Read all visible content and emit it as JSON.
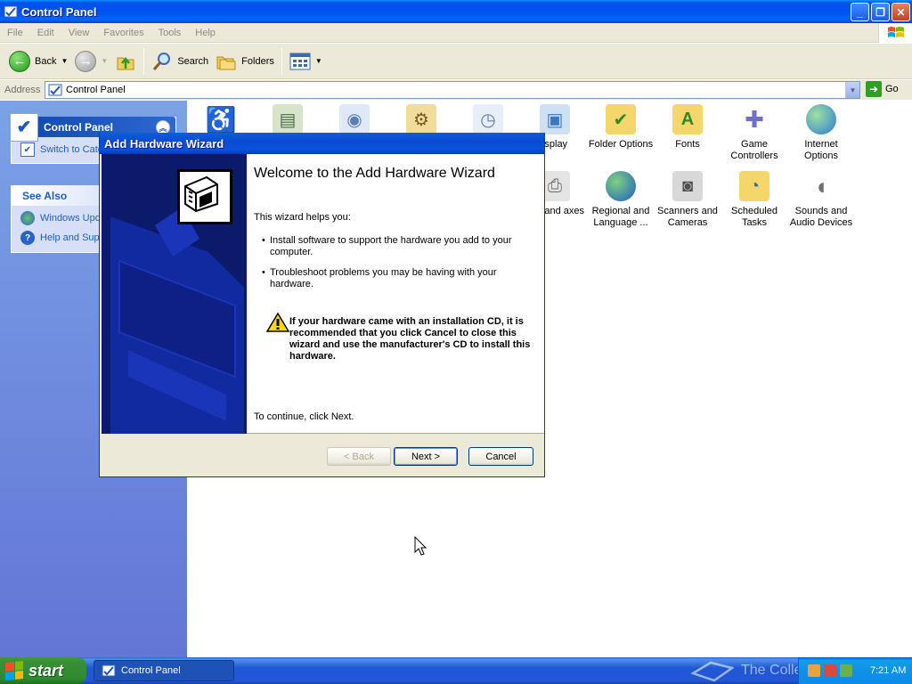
{
  "window": {
    "title": "Control Panel",
    "controls": {
      "minimize": "_",
      "maximize": "❐",
      "close": "✕"
    }
  },
  "menu": [
    "File",
    "Edit",
    "View",
    "Favorites",
    "Tools",
    "Help"
  ],
  "toolbar": {
    "back_label": "Back",
    "search_label": "Search",
    "folders_label": "Folders"
  },
  "address": {
    "label": "Address",
    "value": "Control Panel",
    "go_label": "Go"
  },
  "taskpane": {
    "control_panel": {
      "title": "Control Panel",
      "link": "Switch to Category View"
    },
    "see_also": {
      "title": "See Also",
      "links": [
        "Windows Update",
        "Help and Support"
      ]
    }
  },
  "icons": [
    {
      "label": "",
      "icon": "accessibility-icon",
      "color": "#2b8a2b"
    },
    {
      "label": "",
      "icon": "add-hardware-icon",
      "color": "#4d6b4d"
    },
    {
      "label": "",
      "icon": "add-remove-programs-icon",
      "color": "#5a7fb8"
    },
    {
      "label": "",
      "icon": "administrative-tools-icon",
      "color": "#c8a24c"
    },
    {
      "label": "",
      "icon": "date-time-icon",
      "color": "#5c7fae"
    },
    {
      "label": "isplay",
      "icon": "display-icon",
      "color": "#3a78c8"
    },
    {
      "label": "Folder Options",
      "icon": "folder-options-icon",
      "color": "#e8c24a"
    },
    {
      "label": "Fonts",
      "icon": "fonts-icon",
      "color": "#e8c24a"
    },
    {
      "label": "Game Controllers",
      "icon": "game-controllers-icon",
      "color": "#8a8ad8"
    },
    {
      "label": "Internet Options",
      "icon": "internet-options-icon",
      "color": "#3a8ad8"
    },
    {
      "label": "ters and axes",
      "icon": "printers-faxes-icon",
      "color": "#8a8a8a"
    },
    {
      "label": "Regional and Language ...",
      "icon": "regional-language-icon",
      "color": "#2b7ad8"
    },
    {
      "label": "Scanners and Cameras",
      "icon": "scanners-cameras-icon",
      "color": "#7a7a7a"
    },
    {
      "label": "Scheduled Tasks",
      "icon": "scheduled-tasks-icon",
      "color": "#e8c24a"
    },
    {
      "label": "Sounds and Audio Devices",
      "icon": "sounds-audio-icon",
      "color": "#8a8a8a"
    }
  ],
  "dialog": {
    "title": "Add Hardware Wizard",
    "heading": "Welcome to the Add Hardware Wizard",
    "intro": "This wizard helps you:",
    "bullets": [
      "Install software to support the hardware you add to your computer.",
      "Troubleshoot problems you may be having with your hardware."
    ],
    "warning": "If your hardware came with an installation CD, it is recommended that you click Cancel to close this wizard and use the manufacturer's CD to install this hardware.",
    "continue": "To continue, click Next.",
    "buttons": {
      "back": "< Back",
      "next": "Next >",
      "cancel": "Cancel"
    }
  },
  "taskbar": {
    "start_label": "start",
    "task_item": "Control Panel",
    "watermark": "The Collection Book",
    "clock": "7:21 AM"
  }
}
